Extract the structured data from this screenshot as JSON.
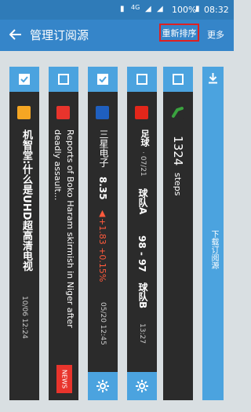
{
  "status": {
    "battery": "100%",
    "time": "08:32",
    "network": "4G"
  },
  "header": {
    "title": "管理订阅源",
    "reorder_label": "重新排序",
    "more_label": "更多"
  },
  "cards": [
    {
      "checked": true,
      "title": "机智堂:什么是UHD超高清电视",
      "time": "10/06 12:24",
      "icon_color": "#f5a623"
    },
    {
      "checked": false,
      "title": "Reports of Boko Haram skirmish in Niger after deadly assault...",
      "badge": "NEWS",
      "icon_color": "#e8342c"
    },
    {
      "checked": true,
      "name": "三星电子",
      "value": "8.35",
      "change": "▲+1.83 +0.15%",
      "time": "05/20 12:45",
      "icon_color": "#1f5fbf"
    },
    {
      "checked": false,
      "league": "足球",
      "date": "· 07/21",
      "team_a": "球队A",
      "score": "98 - 97",
      "team_b": "球队B",
      "time": "13:27",
      "icon_color": "#e3261a"
    },
    {
      "checked": false,
      "steps_value": "1324",
      "steps_unit": "steps",
      "icon_color": "#3aa33f"
    }
  ],
  "download": {
    "label": "下载订阅源"
  },
  "colors": {
    "accent": "#3585c9",
    "check_blue": "#4ba3df",
    "red": "#e02020"
  }
}
